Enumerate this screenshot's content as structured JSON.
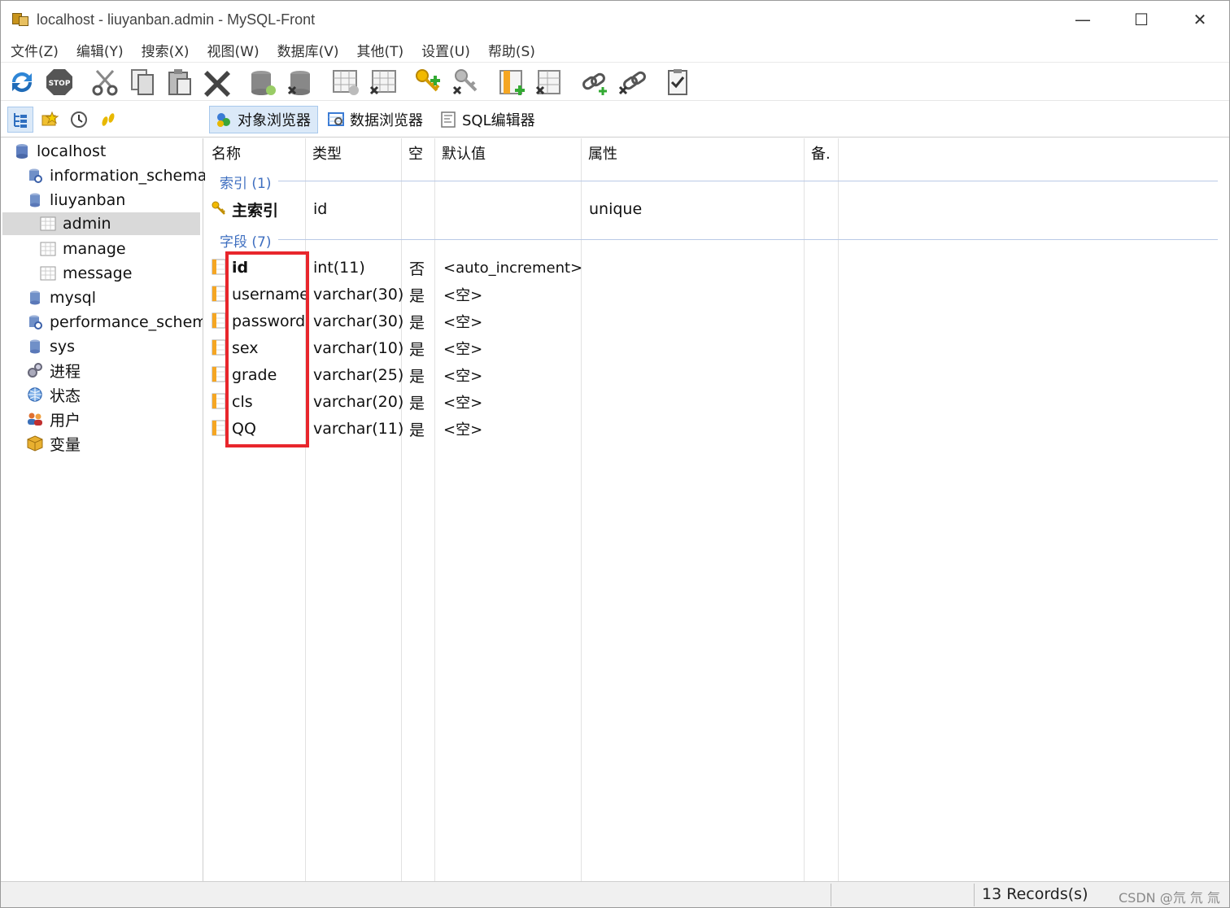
{
  "window": {
    "title": "localhost - liuyanban.admin - MySQL-Front",
    "minimize_glyph": "—",
    "maximize_glyph": "☐",
    "close_glyph": "✕"
  },
  "menu": [
    {
      "label": "文件(Z)"
    },
    {
      "label": "编辑(Y)"
    },
    {
      "label": "搜索(X)"
    },
    {
      "label": "视图(W)"
    },
    {
      "label": "数据库(V)"
    },
    {
      "label": "其他(T)"
    },
    {
      "label": "设置(U)"
    },
    {
      "label": "帮助(S)"
    }
  ],
  "toolbar": {
    "icons": [
      "refresh-icon",
      "stop-icon",
      "cut-icon",
      "copy-icon",
      "paste-icon",
      "delete-icon",
      "add-database-icon",
      "delete-database-icon",
      "add-table-icon",
      "delete-table-icon",
      "add-key-icon",
      "delete-key-icon",
      "add-field-icon",
      "delete-field-icon",
      "add-link-icon",
      "delete-link-icon",
      "checklist-icon"
    ],
    "stop_label": "STOP"
  },
  "view_tabs": [
    {
      "label": "对象浏览器",
      "active": true
    },
    {
      "label": "数据浏览器",
      "active": false
    },
    {
      "label": "SQL编辑器",
      "active": false
    }
  ],
  "tree": {
    "items": [
      {
        "label": "localhost"
      },
      {
        "label": "information_schema"
      },
      {
        "label": "liuyanban"
      },
      {
        "label": "admin",
        "selected": true
      },
      {
        "label": "manage"
      },
      {
        "label": "message"
      },
      {
        "label": "mysql"
      },
      {
        "label": "performance_schema"
      },
      {
        "label": "sys"
      },
      {
        "label": "进程"
      },
      {
        "label": "状态"
      },
      {
        "label": "用户"
      },
      {
        "label": "变量"
      }
    ]
  },
  "grid": {
    "columns": [
      {
        "label": "名称"
      },
      {
        "label": "类型"
      },
      {
        "label": "空"
      },
      {
        "label": "默认值"
      },
      {
        "label": "属性"
      },
      {
        "label": "备."
      }
    ],
    "index_group": "索引 (1)",
    "index_rows": [
      {
        "name": "主索引",
        "type": "id",
        "attr": "unique"
      }
    ],
    "field_group": "字段 (7)",
    "field_rows": [
      {
        "name": "id",
        "type": "int(11)",
        "null": "否",
        "default": "<auto_increment>"
      },
      {
        "name": "username",
        "type": "varchar(30)",
        "null": "是",
        "default": "<空>"
      },
      {
        "name": "password",
        "type": "varchar(30)",
        "null": "是",
        "default": "<空>"
      },
      {
        "name": "sex",
        "type": "varchar(10)",
        "null": "是",
        "default": "<空>"
      },
      {
        "name": "grade",
        "type": "varchar(25)",
        "null": "是",
        "default": "<空>"
      },
      {
        "name": "cls",
        "type": "varchar(20)",
        "null": "是",
        "default": "<空>"
      },
      {
        "name": "QQ",
        "type": "varchar(11)",
        "null": "是",
        "default": "<空>"
      }
    ]
  },
  "status": {
    "records": "13 Records(s)",
    "watermark": "CSDN @氘 氘 氚"
  }
}
